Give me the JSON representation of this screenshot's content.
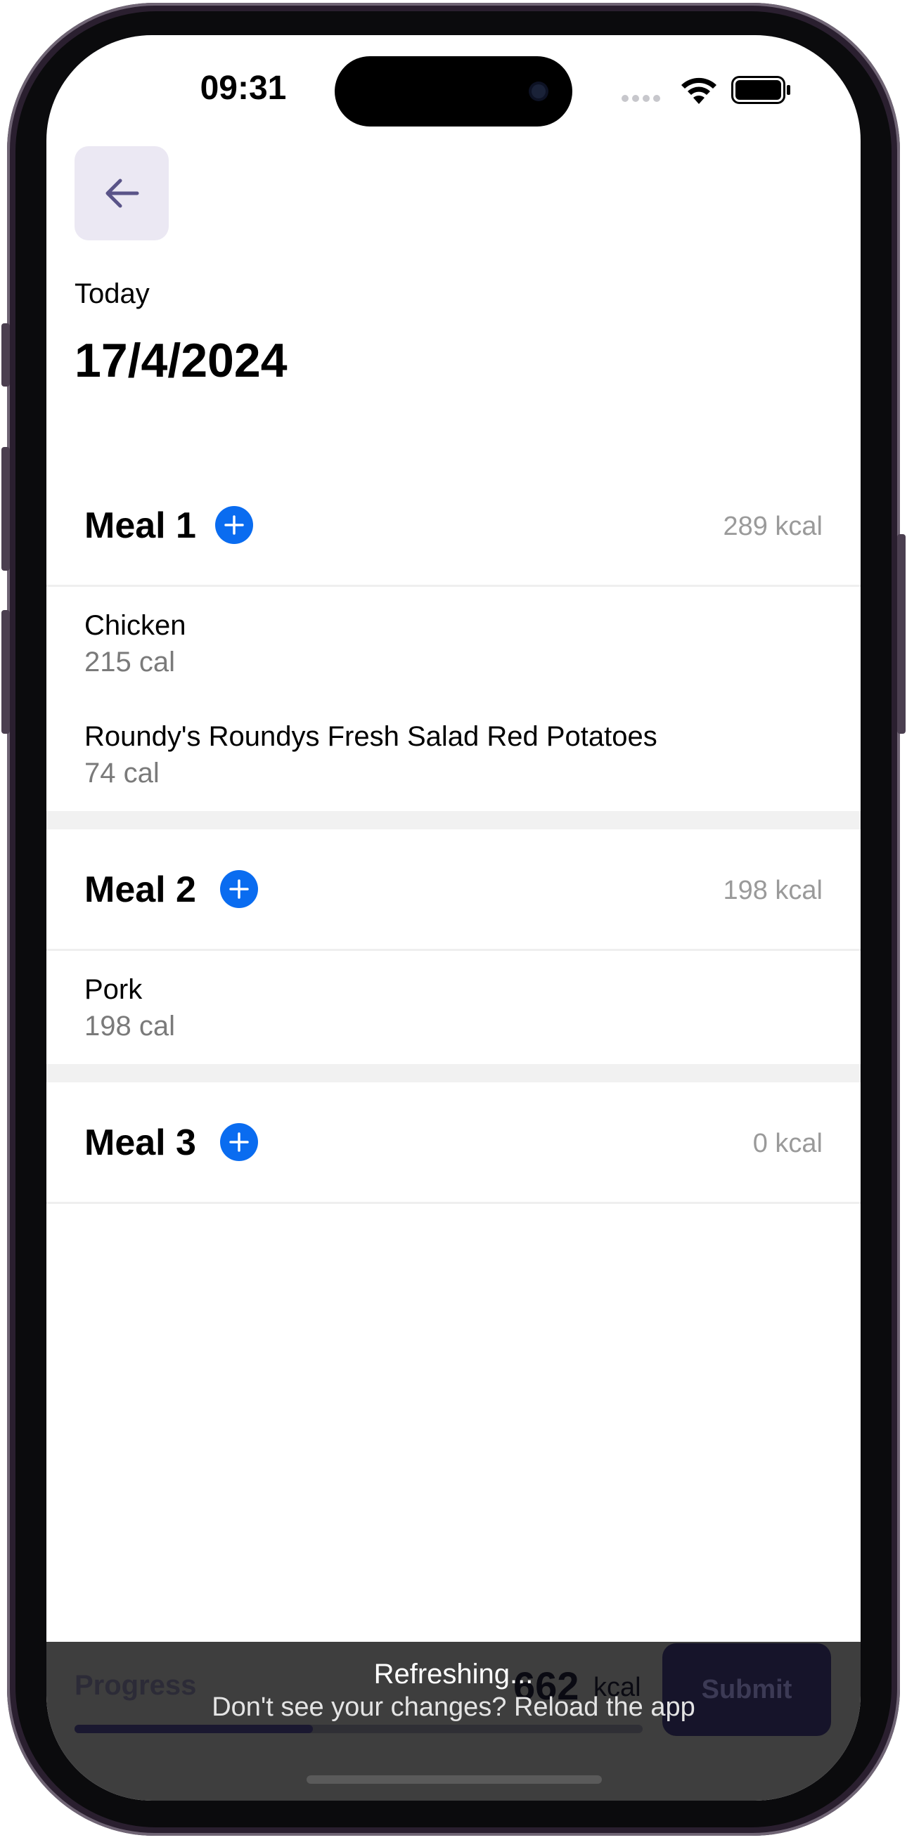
{
  "status_bar": {
    "time": "09:31"
  },
  "header": {
    "back_icon": "arrow-left-icon",
    "today_label": "Today",
    "date": "17/4/2024"
  },
  "meals": [
    {
      "title": "Meal 1",
      "kcal": "289 kcal",
      "items": [
        {
          "name": "Chicken",
          "cal": "215 cal"
        },
        {
          "name": "Roundy's Roundys Fresh Salad Red Potatoes",
          "cal": "74 cal"
        }
      ]
    },
    {
      "title": "Meal 2",
      "kcal": "198 kcal",
      "items": [
        {
          "name": "Pork",
          "cal": "198 cal"
        }
      ]
    },
    {
      "title": "Meal 3",
      "kcal": "0 kcal",
      "items": []
    }
  ],
  "bottom": {
    "progress_label": "Progress",
    "progress_fraction": 0.42,
    "total_value": "662",
    "total_unit": "kcal",
    "submit_label": "Submit"
  },
  "toast": {
    "title": "Refreshing...",
    "subtitle": "Don't see your changes? Reload the app"
  },
  "colors": {
    "accent": "#0a6cf0",
    "back_button_bg": "#ebe8f3",
    "back_arrow": "#5a5488"
  }
}
